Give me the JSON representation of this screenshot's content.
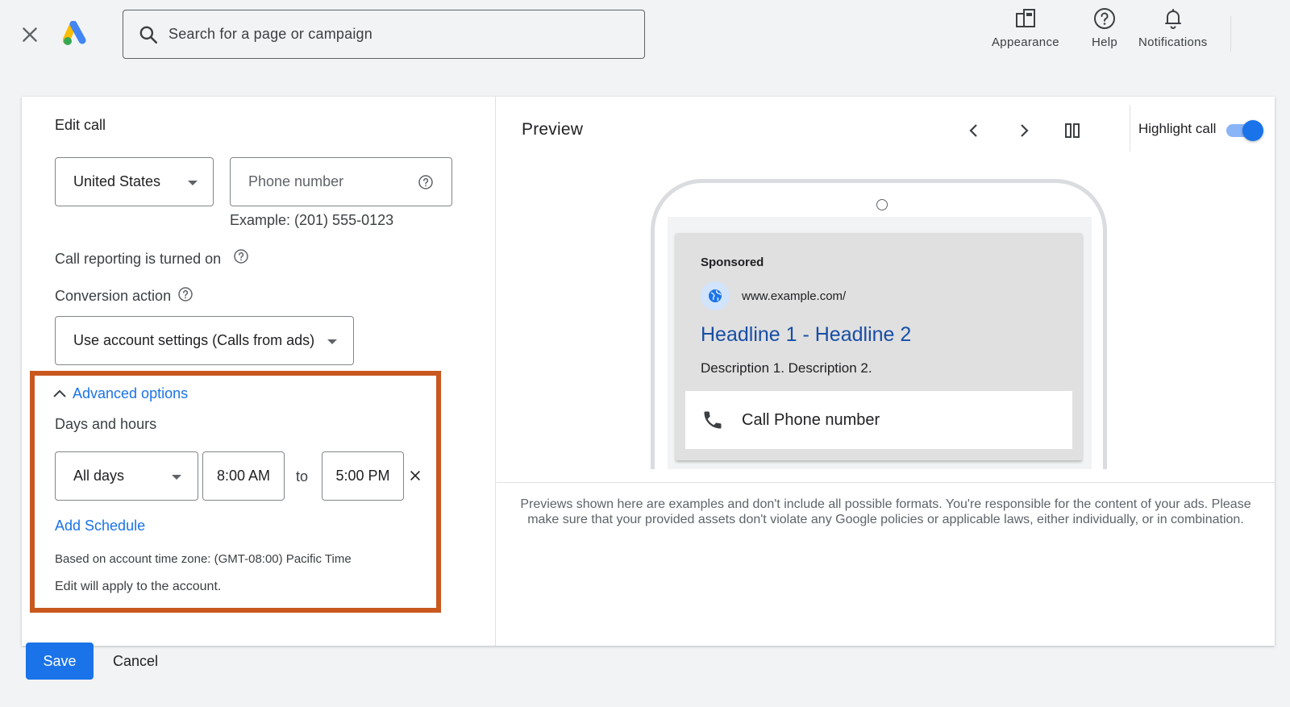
{
  "header": {
    "search_placeholder": "Search for a page or campaign",
    "actions": [
      {
        "label": "Appearance",
        "icon": "appearance-icon"
      },
      {
        "label": "Help",
        "icon": "help-icon"
      },
      {
        "label": "Notifications",
        "icon": "bell-icon"
      }
    ]
  },
  "edit": {
    "title": "Edit call",
    "country": "United States",
    "phone_placeholder": "Phone number",
    "phone_example": "Example: (201) 555-0123",
    "call_reporting": "Call reporting is turned on",
    "conversion_label": "Conversion action",
    "conversion_value": "Use account settings (Calls from ads)",
    "advanced_label": "Advanced options",
    "days_hours_label": "Days and hours",
    "schedule": {
      "days": "All days",
      "start": "8:00 AM",
      "to": "to",
      "end": "5:00 PM"
    },
    "add_schedule": "Add Schedule",
    "timezone_note": "Based on account time zone: (GMT-08:00) Pacific Time",
    "apply_note": "Edit will apply to the account."
  },
  "preview": {
    "title": "Preview",
    "highlight_label": "Highlight call",
    "highlight_on": true,
    "ad": {
      "sponsored": "Sponsored",
      "url": "www.example.com/",
      "headline": "Headline 1 - Headline 2",
      "description": "Description 1. Description 2.",
      "call_text": "Call Phone number"
    },
    "disclaimer": "Previews shown here are examples and don't include all possible formats. You're responsible for the content of your ads. Please make sure that your provided assets don't violate any Google policies or applicable laws, either individually, or in combination."
  },
  "footer": {
    "save": "Save",
    "cancel": "Cancel"
  },
  "colors": {
    "accent": "#1a73e8",
    "highlight_border": "#c9581f",
    "headline": "#174ea6"
  }
}
